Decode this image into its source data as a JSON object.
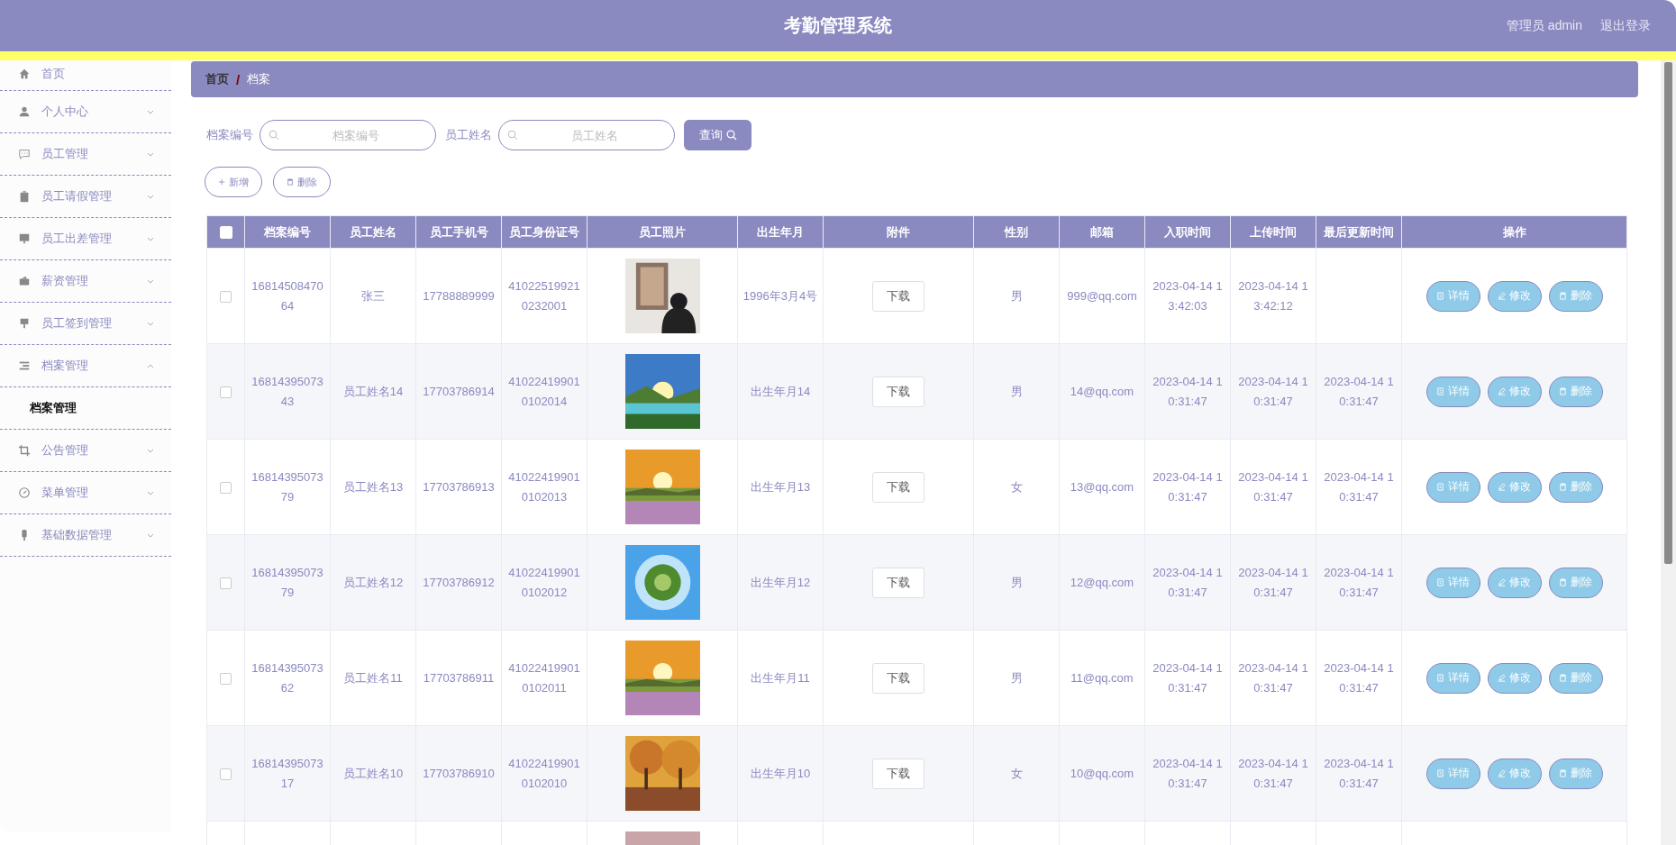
{
  "header": {
    "title": "考勤管理系统",
    "user": "管理员 admin",
    "logout": "退出登录"
  },
  "sidebar": {
    "items": [
      {
        "label": "首页",
        "kind": "link"
      },
      {
        "label": "个人中心",
        "kind": "menu",
        "expanded": false
      },
      {
        "label": "员工管理",
        "kind": "menu",
        "expanded": false
      },
      {
        "label": "员工请假管理",
        "kind": "menu",
        "expanded": false
      },
      {
        "label": "员工出差管理",
        "kind": "menu",
        "expanded": false
      },
      {
        "label": "薪资管理",
        "kind": "menu",
        "expanded": false
      },
      {
        "label": "员工签到管理",
        "kind": "menu",
        "expanded": false
      },
      {
        "label": "档案管理",
        "kind": "menu",
        "expanded": true,
        "children": [
          {
            "label": "档案管理",
            "selected": true
          }
        ]
      },
      {
        "label": "公告管理",
        "kind": "menu",
        "expanded": false
      },
      {
        "label": "菜单管理",
        "kind": "menu",
        "expanded": false
      },
      {
        "label": "基础数据管理",
        "kind": "menu",
        "expanded": false
      }
    ]
  },
  "breadcrumb": [
    "首页",
    "/",
    "档案"
  ],
  "search": {
    "fields": [
      {
        "label": "档案编号",
        "placeholder": "档案编号"
      },
      {
        "label": "员工姓名",
        "placeholder": "员工姓名"
      }
    ],
    "button": "查询"
  },
  "actions": [
    "新增",
    "删除"
  ],
  "table": {
    "header_checked": false,
    "columns": [
      "档案编号",
      "员工姓名",
      "员工手机号",
      "员工身份证号",
      "员工照片",
      "出生年月",
      "附件",
      "性别",
      "邮箱",
      "入职时间",
      "上传时间",
      "最后更新时间",
      "操作"
    ],
    "rows": [
      {
        "checked": false,
        "cells": [
          "1681450847064",
          "张三",
          "17788889999",
          "410225199210232001"
        ],
        "photo": {
          "kind": "picture"
        },
        "birth": "1996年3月4号",
        "file": "下载",
        "gender": "男",
        "email": "999@qq.com",
        "joined": "2023-04-14 13:42:03",
        "uploaded": "2023-04-14 13:42:12",
        "buttons": [
          "详情",
          "修改",
          "删除"
        ]
      },
      {
        "checked": false,
        "cells": [
          "1681439507343",
          "员工姓名14",
          "17703786914",
          "410224199010102014"
        ],
        "photo": {
          "kind": "picture"
        },
        "birth": "出生年月14",
        "file": "下载",
        "gender": "男",
        "email": "14@qq.com",
        "joined": "2023-04-14 10:31:47",
        "uploaded": "2023-04-14 10:31:47",
        "updated": "2023-04-14 10:31:47",
        "buttons": [
          "详情",
          "修改",
          "删除"
        ]
      },
      {
        "checked": false,
        "cells": [
          "1681439507379",
          "员工姓名13",
          "17703786913",
          "410224199010102013"
        ],
        "photo": {
          "kind": "picture"
        },
        "birth": "出生年月13",
        "file": "下载",
        "gender": "女",
        "email": "13@qq.com",
        "joined": "2023-04-14 10:31:47",
        "uploaded": "2023-04-14 10:31:47",
        "updated": "2023-04-14 10:31:47",
        "buttons": [
          "详情",
          "修改",
          "删除"
        ]
      },
      {
        "checked": false,
        "cells": [
          "1681439507379",
          "员工姓名12",
          "17703786912",
          "410224199010102012"
        ],
        "photo": {
          "kind": "picture"
        },
        "birth": "出生年月12",
        "file": "下载",
        "gender": "男",
        "email": "12@qq.com",
        "joined": "2023-04-14 10:31:47",
        "uploaded": "2023-04-14 10:31:47",
        "updated": "2023-04-14 10:31:47",
        "buttons": [
          "详情",
          "修改",
          "删除"
        ]
      },
      {
        "checked": false,
        "cells": [
          "1681439507362",
          "员工姓名11",
          "17703786911",
          "410224199010102011"
        ],
        "photo": {
          "kind": "picture"
        },
        "birth": "出生年月11",
        "file": "下载",
        "gender": "男",
        "email": "11@qq.com",
        "joined": "2023-04-14 10:31:47",
        "uploaded": "2023-04-14 10:31:47",
        "updated": "2023-04-14 10:31:47",
        "buttons": [
          "详情",
          "修改",
          "删除"
        ]
      },
      {
        "checked": false,
        "cells": [
          "1681439507317",
          "员工姓名10",
          "17703786910",
          "410224199010102010"
        ],
        "photo": {
          "kind": "picture"
        },
        "birth": "出生年月10",
        "file": "下载",
        "gender": "女",
        "email": "10@qq.com",
        "joined": "2023-04-14 10:31:47",
        "uploaded": "2023-04-14 10:31:47",
        "updated": "2023-04-14 10:31:47",
        "buttons": [
          "详情",
          "修改",
          "删除"
        ]
      },
      {
        "photo": {
          "kind": "picture"
        }
      }
    ]
  }
}
